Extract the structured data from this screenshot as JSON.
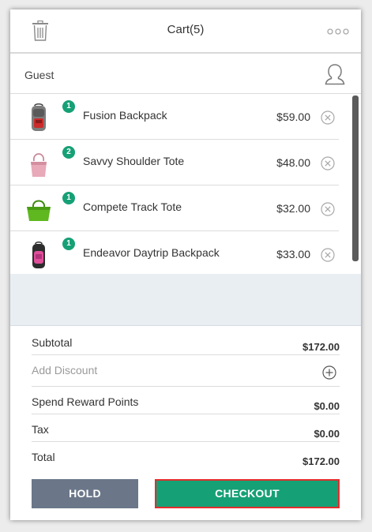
{
  "header": {
    "title": "Cart(5)",
    "left_icon": "trash-icon",
    "right_icon": "more-icon"
  },
  "customer": {
    "name": "Guest",
    "icon": "user-icon"
  },
  "items": [
    {
      "qty": "1",
      "name": "Fusion Backpack",
      "price": "$59.00",
      "thumb": "backpack-gray"
    },
    {
      "qty": "2",
      "name": "Savvy Shoulder Tote",
      "price": "$48.00",
      "thumb": "tote-pink"
    },
    {
      "qty": "1",
      "name": "Compete Track Tote",
      "price": "$32.00",
      "thumb": "tote-green"
    },
    {
      "qty": "1",
      "name": "Endeavor Daytrip Backpack",
      "price": "$33.00",
      "thumb": "backpack-pink"
    }
  ],
  "totals": {
    "subtotal_label": "Subtotal",
    "subtotal_value": "$172.00",
    "discount_label": "Add Discount",
    "reward_label": "Spend Reward Points",
    "reward_value": "$0.00",
    "tax_label": "Tax",
    "tax_value": "$0.00",
    "total_label": "Total",
    "total_value": "$172.00"
  },
  "actions": {
    "hold_label": "HOLD",
    "checkout_label": "CHECKOUT"
  },
  "colors": {
    "accent_green": "#16a075",
    "hold_gray": "#6b7789",
    "highlight_red": "#e32d2d"
  }
}
